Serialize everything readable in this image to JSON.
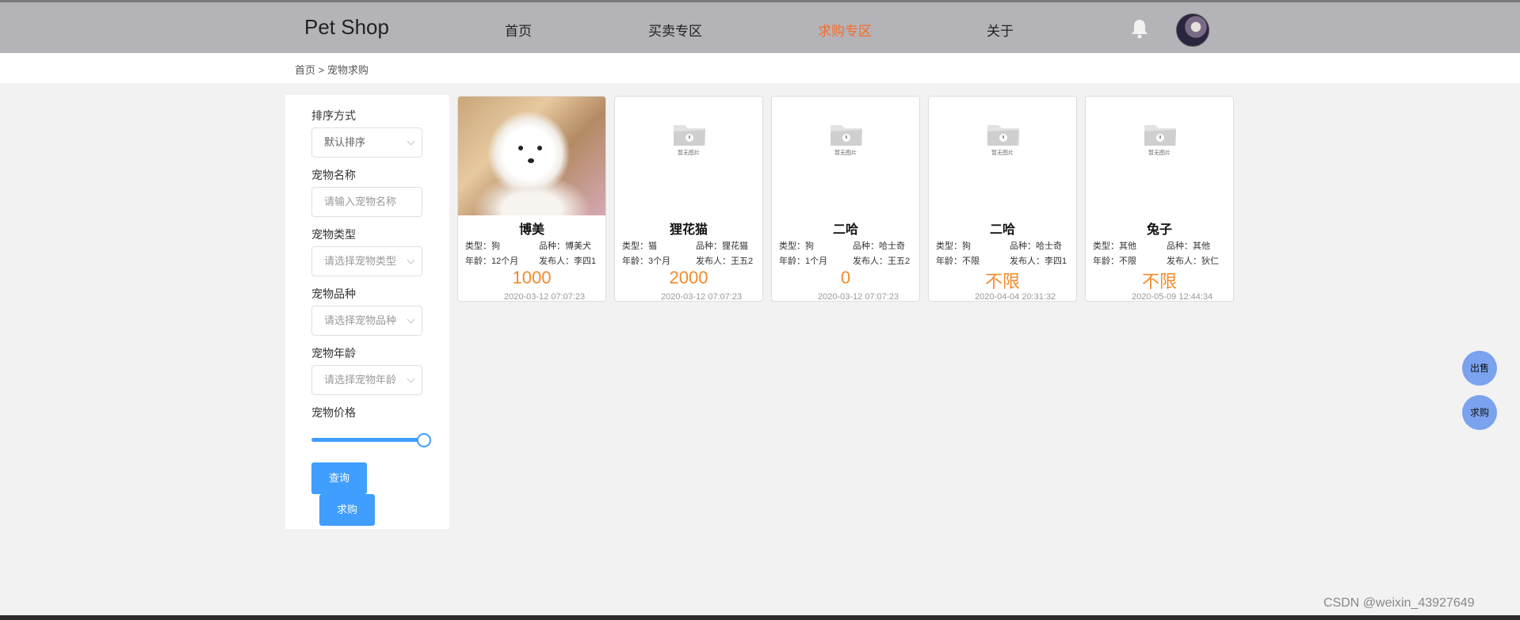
{
  "header": {
    "brand": "Pet Shop",
    "nav": [
      "首页",
      "买卖专区",
      "求购专区",
      "关于"
    ],
    "active_nav": "求购专区",
    "active_color": "#f56c2b",
    "icons": [
      "bell-icon",
      "avatar"
    ]
  },
  "breadcrumb": "首页 > 宠物求购",
  "filter": {
    "sort_label": "排序方式",
    "sort_value": "默认排序",
    "name_label": "宠物名称",
    "name_placeholder": "请输入宠物名称",
    "type_label": "宠物类型",
    "type_placeholder": "请选择宠物类型",
    "breed_label": "宠物品种",
    "breed_placeholder": "请选择宠物品种",
    "age_label": "宠物年龄",
    "age_placeholder": "请选择宠物年龄",
    "price_label": "宠物价格",
    "price_slider_fraction": 1.0,
    "search_button": "查询",
    "request_button": "求购"
  },
  "cards": [
    {
      "title": "博美",
      "type": "类型：狗",
      "breed": "品种：博美犬",
      "age": "年龄：12个月",
      "publisher": "发布人：李四1",
      "price": "1000",
      "date": "2020-03-12 07:07:23",
      "has_photo": true
    },
    {
      "title": "狸花猫",
      "type": "类型：猫",
      "breed": "品种：狸花猫",
      "age": "年龄：3个月",
      "publisher": "发布人：王五2",
      "price": "2000",
      "date": "2020-03-12 07:07:23",
      "has_photo": false
    },
    {
      "title": "二哈",
      "type": "类型：狗",
      "breed": "品种：哈士奇",
      "age": "年龄：1个月",
      "publisher": "发布人：王五2",
      "price": "0",
      "date": "2020-03-12 07:07:23",
      "has_photo": false
    },
    {
      "title": "二哈",
      "type": "类型：狗",
      "breed": "品种：哈士奇",
      "age": "年龄：不限",
      "publisher": "发布人：李四1",
      "price": "不限",
      "date": "2020-04-04 20:31:32",
      "has_photo": false
    },
    {
      "title": "兔子",
      "type": "类型：其他",
      "breed": "品种：其他",
      "age": "年龄：不限",
      "publisher": "发布人：狄仁",
      "price": "不限",
      "date": "2020-05-09 12:44:34",
      "has_photo": false
    }
  ],
  "no_image_text": "暂无图片",
  "price_color": "#f58a2a",
  "float_buttons": [
    "出售",
    "求购"
  ],
  "watermark": "CSDN @weixin_43927649"
}
